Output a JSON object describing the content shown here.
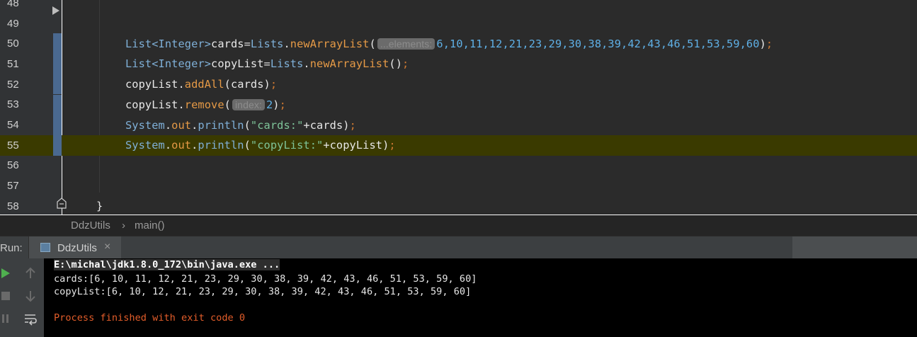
{
  "editor": {
    "line_numbers": [
      "48",
      "49",
      "50",
      "51",
      "52",
      "53",
      "54",
      "55",
      "56",
      "57",
      "58"
    ],
    "line50": {
      "type": "List<Integer>",
      "var": "cards",
      "eq": "=",
      "cls": "Lists",
      "dot": ".",
      "method": "newArrayList",
      "open": "(",
      "hint": "...elements:",
      "args": "6,10,11,12,21,23,29,30,38,39,42,43,46,51,53,59,60",
      "close": ")",
      "semi": ";"
    },
    "line51": {
      "type": "List<Integer>",
      "var": "copyList",
      "eq": "=",
      "cls": "Lists",
      "dot": ".",
      "method": "newArrayList",
      "parens": "()",
      "semi": ";"
    },
    "line52": {
      "obj": "copyList",
      "dot": ".",
      "method": "addAll",
      "args": "(cards)",
      "semi": ";"
    },
    "line53": {
      "obj": "copyList",
      "dot": ".",
      "method": "remove",
      "open": "(",
      "hint": "index:",
      "arg": "2",
      "close": ")",
      "semi": ";"
    },
    "line54": {
      "cls": "System",
      "dot1": ".",
      "field": "out",
      "dot2": ".",
      "method": "println",
      "open": "(",
      "str": "\"cards:\"",
      "rest": "+cards)",
      "semi": ";"
    },
    "line55": {
      "cls": "System",
      "dot1": ".",
      "field": "out",
      "dot2": ".",
      "method": "println",
      "open": "(",
      "str": "\"copyList:\"",
      "rest": "+copyList)",
      "semi": ";"
    },
    "line58": {
      "brace": "}"
    }
  },
  "breadcrumb": {
    "file": "DdzUtils",
    "sep": "›",
    "method": "main()"
  },
  "run": {
    "label": "Run:",
    "tab_label": "DdzUtils",
    "tab_close": "×"
  },
  "console": {
    "cmd": "E:\\michal\\jdk1.8.0_172\\bin\\java.exe ...",
    "out1": "cards:[6, 10, 11, 12, 21, 23, 29, 30, 38, 39, 42, 43, 46, 51, 53, 59, 60]",
    "out2": "copyList:[6, 10, 12, 21, 23, 29, 30, 38, 39, 42, 43, 46, 51, 53, 59, 60]",
    "exit": "Process finished with exit code 0"
  },
  "colors": {
    "keyword": "#7fb0d8",
    "method": "#e69a46",
    "number": "#5fb0e6",
    "string": "#7fc59a",
    "semicolon": "#cc7832",
    "current_line": "#3a3a00",
    "exit_text": "#e35d2a"
  },
  "icons": {
    "run": "play-icon",
    "stop": "stop-icon",
    "up": "arrow-up-icon",
    "down": "arrow-down-icon",
    "pause": "pause-icon",
    "wrap": "soft-wrap-icon"
  }
}
